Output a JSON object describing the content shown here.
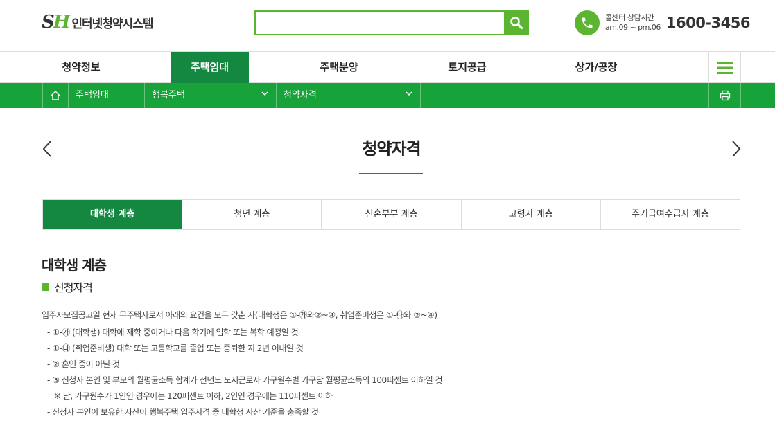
{
  "header": {
    "logo_mark_s": "S",
    "logo_mark_h": "H",
    "logo_text": "인터넷청약시스템",
    "search_placeholder": "",
    "call": {
      "title": "콜센터 상담시간",
      "hours": "am.09 ~ pm.06",
      "number": "1600-3456"
    }
  },
  "gnb": {
    "items": [
      "청약정보",
      "주택임대",
      "주택분양",
      "토지공급",
      "상가/공장"
    ],
    "active_index": 1
  },
  "location": {
    "level1": "주택임대",
    "level2": "행복주택",
    "level3": "청약자격"
  },
  "page": {
    "title": "청약자격"
  },
  "tabs": {
    "items": [
      "대학생 계층",
      "청년 계층",
      "신혼부부 계층",
      "고령자 계층",
      "주거급여수급자 계층"
    ],
    "active_index": 0
  },
  "content": {
    "section_title": "대학생 계층",
    "sub_title": "신청자격",
    "intro": "입주자모집공고일 현재 무주택자로서 아래의 요건을 모두 갖춘 자(대학생은 ①-㉮와②~④, 취업준비생은 ①-㉯와 ②~④)",
    "requirements": [
      "- ①-㉮ (대학생) 대학에 재학 중이거나 다음 학기에 입학 또는 복학 예정일 것",
      "- ①-㉯ (취업준비생) 대학 또는 고등학교를 졸업 또는 중퇴한 지 2년 이내일 것",
      "- ② 혼인 중이 아닐 것",
      "- ③ 신청자 본인 및 부모의 월평균소득 합계가 전년도 도시근로자 가구원수별 가구당 월평균소득의 100퍼센트 이하일 것",
      "※ 단, 가구원수가 1인인 경우에는 120퍼센트 이하, 2인인 경우에는 110퍼센트 이하",
      "- 신청자 본인이 보유한 자산이 행복주택 입주자격 중 대학생 자산 기준을 충족할 것"
    ]
  },
  "colors": {
    "brand_green": "#5cb531",
    "dark_green": "#148840",
    "bar_green": "#17a23a"
  }
}
